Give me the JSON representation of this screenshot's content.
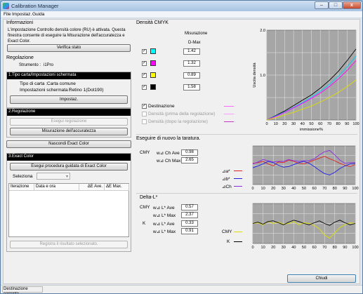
{
  "window": {
    "title": "Calibration Manager",
    "min": "–",
    "max": "□",
    "close": "x"
  },
  "menu": [
    "File",
    "Impostaz.",
    "Guida"
  ],
  "info": {
    "heading": "Informazioni",
    "text": [
      "L'impostazione Controllo densità colore (RU) è attivata. Questa",
      "finestra consente di eseguire la Misurazione dell'accuratezza e",
      "Exact Color."
    ],
    "verify_btn": "Verifica stato"
  },
  "regolazione": {
    "heading": "Regolazione",
    "strumento_label": "Strumento :",
    "strumento_value": "i1Pro",
    "sec1_title": "1.Tipo carta/Impostazioni schermata",
    "paper_label": "Tipo di carta :",
    "paper_value": "Carta comune",
    "screen_label": "Impostazioni schermata :",
    "screen_value": "Retino 1(Dot190)",
    "impostaz_btn": "Impostaz.",
    "sec2_title": "2.Regolazione",
    "esegui_reg_btn": "Esegui regolazione",
    "misurazione_btn": "Misurazione dell'accuratezza",
    "nascondi_btn": "Nascondi Exact Color",
    "sec3_title": "3.Exact Color",
    "esegui_exact_btn": "Esegui procedura guidata di Exact Color",
    "seleziona_label": "Seleziona",
    "table_headers": [
      "Iterazione",
      "Data e ora",
      "ΔE Ave.",
      "ΔE Max."
    ],
    "registra_btn": "Registra il risultato selezionato."
  },
  "cmyk": {
    "heading": "Densità CMYK",
    "col_header_1": "Misurazione",
    "col_header_2": "D-Max",
    "rows": [
      {
        "color": "#00ffff",
        "checked": "✓",
        "value": "1.42"
      },
      {
        "color": "#ff00ff",
        "checked": "✓",
        "value": "1.32"
      },
      {
        "color": "#ffff00",
        "checked": "✓",
        "value": "0.89"
      },
      {
        "color": "#000000",
        "checked": "✓",
        "value": "1.58"
      }
    ],
    "legend": [
      {
        "label": "Destinazione",
        "checked": "✓",
        "color": "#ff66ff",
        "enabled": true
      },
      {
        "label": "Densità (prima della regolazione)",
        "checked": "",
        "color": "#ff99ff",
        "enabled": false
      },
      {
        "label": "Densità (dopo la regolazione)",
        "checked": "",
        "color": "#cc33cc",
        "enabled": false
      }
    ]
  },
  "retune": {
    "heading": "Eseguire di nuovo la taratura.",
    "cmy_label": "CMY",
    "rows": [
      {
        "label": "w⊿ Ch Ave",
        "value": "0.98"
      },
      {
        "label": "w⊿ Ch Max",
        "value": "2.65"
      }
    ],
    "legend": [
      {
        "label": "⊿a*",
        "color": "#e02020"
      },
      {
        "label": "⊿b*",
        "color": "#2020e0"
      },
      {
        "label": "⊿Ch",
        "color": "#8a2be2"
      }
    ]
  },
  "deltaL": {
    "heading": "Delta-L*",
    "cmy_label": "CMY",
    "k_label": "K",
    "rows": [
      {
        "label": "w⊿ L* Ave",
        "value": "0.57"
      },
      {
        "label": "w⊿ L* Max",
        "value": "2.37"
      },
      {
        "label": "w⊿ L* Ave",
        "value": "0.33"
      },
      {
        "label": "w⊿ L* Max",
        "value": "0.91"
      }
    ],
    "legend": [
      {
        "label": "CMY",
        "color": "#ffff00"
      },
      {
        "label": "K",
        "color": "#000000"
      }
    ]
  },
  "chiudi_btn": "Chiudi",
  "status": "Destinazione corrente",
  "chart_data": [
    {
      "type": "line",
      "xlabel": "immissione%",
      "ylabel": "Uscita densità",
      "x": [
        0,
        10,
        20,
        30,
        40,
        50,
        60,
        70,
        80,
        90,
        100
      ],
      "ylim": [
        0,
        2.0
      ],
      "yticks": [
        1.0,
        2.0
      ],
      "xticks": [
        0,
        10,
        20,
        30,
        40,
        50,
        60,
        70,
        80,
        90,
        100
      ],
      "series": [
        {
          "color": "#000000",
          "values": [
            0.0,
            0.1,
            0.2,
            0.32,
            0.44,
            0.56,
            0.71,
            0.88,
            1.08,
            1.32,
            1.58
          ]
        },
        {
          "color": "#00c8ff",
          "values": [
            0.0,
            0.09,
            0.18,
            0.28,
            0.39,
            0.51,
            0.64,
            0.79,
            0.97,
            1.18,
            1.42
          ]
        },
        {
          "color": "#ff00ff",
          "values": [
            0.0,
            0.08,
            0.17,
            0.27,
            0.37,
            0.48,
            0.6,
            0.74,
            0.91,
            1.1,
            1.32
          ]
        },
        {
          "color": "#e0e000",
          "values": [
            0.0,
            0.05,
            0.11,
            0.17,
            0.24,
            0.31,
            0.4,
            0.5,
            0.61,
            0.74,
            0.89
          ]
        }
      ]
    },
    {
      "type": "line",
      "x": [
        0,
        5,
        10,
        15,
        20,
        25,
        30,
        35,
        40,
        45,
        50,
        55,
        60,
        65,
        70,
        75,
        80,
        85,
        90,
        95,
        100
      ],
      "xticks": [
        0,
        10,
        20,
        30,
        40,
        50,
        60,
        70,
        80,
        90,
        100
      ],
      "ylim": [
        -3,
        3
      ],
      "series": [
        {
          "name": "⊿a*",
          "color": "#e02020",
          "values": [
            0.3,
            0.4,
            0.6,
            0.2,
            -0.1,
            0.5,
            0.4,
            0.8,
            0.6,
            0.3,
            0.2,
            0.5,
            0.8,
            1.1,
            1.4,
            1.0,
            0.7,
            0.3,
            0.0,
            -0.2,
            0.1
          ]
        },
        {
          "name": "⊿b*",
          "color": "#2020e0",
          "values": [
            -0.4,
            -0.1,
            0.2,
            0.6,
            0.4,
            0.0,
            -0.3,
            -0.2,
            0.1,
            0.4,
            0.6,
            0.3,
            -0.2,
            -0.8,
            -1.3,
            -1.5,
            -1.1,
            -0.5,
            -0.1,
            0.2,
            0.3
          ]
        },
        {
          "name": "⊿Ch",
          "color": "#8a2be2",
          "values": [
            0.2,
            0.5,
            0.9,
            0.7,
            0.5,
            0.6,
            0.6,
            0.9,
            0.7,
            0.6,
            0.7,
            0.7,
            1.0,
            1.6,
            2.1,
            2.3,
            1.6,
            0.8,
            0.3,
            0.4,
            0.4
          ]
        }
      ]
    },
    {
      "type": "line",
      "x": [
        0,
        5,
        10,
        15,
        20,
        25,
        30,
        35,
        40,
        45,
        50,
        55,
        60,
        65,
        70,
        75,
        80,
        85,
        90,
        95,
        100
      ],
      "xticks": [
        0,
        10,
        20,
        30,
        40,
        50,
        60,
        70,
        80,
        90,
        100
      ],
      "ylim": [
        -3,
        3
      ],
      "series": [
        {
          "name": "CMY",
          "color": "#e0e000",
          "values": [
            0.0,
            0.1,
            -0.2,
            0.3,
            0.0,
            0.2,
            -0.1,
            0.0,
            0.3,
            -0.2,
            0.1,
            0.0,
            -0.3,
            -0.8,
            -1.7,
            -2.2,
            -1.4,
            -0.6,
            -0.2,
            0.1,
            0.0
          ]
        },
        {
          "name": "K",
          "color": "#000000",
          "values": [
            0.0,
            0.2,
            -0.1,
            0.3,
            0.4,
            0.1,
            -0.2,
            0.2,
            0.5,
            0.3,
            0.0,
            -0.2,
            0.1,
            0.4,
            0.0,
            -0.3,
            0.2,
            0.5,
            0.1,
            -0.2,
            0.0
          ]
        }
      ]
    }
  ]
}
